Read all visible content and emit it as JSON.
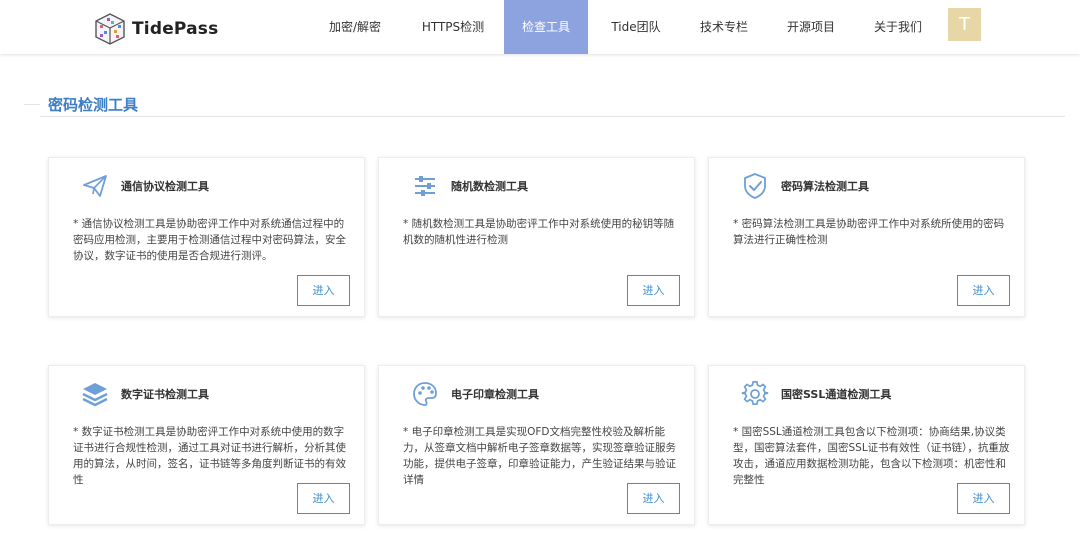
{
  "header": {
    "logo_text": "TidePass",
    "nav": [
      {
        "label": "加密/解密",
        "active": false
      },
      {
        "label": "HTTPS检测",
        "active": false
      },
      {
        "label": "检查工具",
        "active": true
      },
      {
        "label": "Tide团队",
        "active": false
      },
      {
        "label": "技术专栏",
        "active": false
      },
      {
        "label": "开源项目",
        "active": false
      },
      {
        "label": "关于我们",
        "active": false
      }
    ],
    "avatar_letter": "T"
  },
  "section": {
    "title": "密码检测工具"
  },
  "cards": [
    {
      "icon": "paper-plane-icon",
      "title": "通信协议检测工具",
      "desc": "*  通信协议检测工具是协助密评工作中对系统通信过程中的密码应用检测，主要用于检测通信过程中对密码算法，安全协议，数字证书的使用是否合规进行测评。",
      "button": "进入"
    },
    {
      "icon": "sliders-icon",
      "title": "随机数检测工具",
      "desc": "*  随机数检测工具是协助密评工作中对系统使用的秘钥等随机数的随机性进行检测",
      "button": "进入"
    },
    {
      "icon": "shield-check-icon",
      "title": "密码算法检测工具",
      "desc": "*  密码算法检测工具是协助密评工作中对系统所使用的密码算法进行正确性检测",
      "button": "进入"
    },
    {
      "icon": "layers-icon",
      "title": "数字证书检测工具",
      "desc": "*  数字证书检测工具是协助密评工作中对系统中使用的数字证书进行合规性检测，通过工具对证书进行解析，分析其使用的算法，从时间，签名，证书链等多角度判断证书的有效性",
      "button": "进入"
    },
    {
      "icon": "palette-icon",
      "title": "电子印章检测工具",
      "desc": "*  电子印章检测工具是实现OFD文档完整性校验及解析能力，从签章文档中解析电子签章数据等，实现签章验证服务功能，提供电子签章，印章验证能力，产生验证结果与验证详情",
      "button": "进入"
    },
    {
      "icon": "gear-icon",
      "title": "国密SSL通道检测工具",
      "desc": "*  国密SSL通道检测工具包含以下检测项：协商结果,协议类型，国密算法套件，国密SSL证书有效性（证书链），抗重放攻击，通道应用数据检测功能，包含以下检测项：机密性和完整性",
      "button": "进入"
    }
  ]
}
